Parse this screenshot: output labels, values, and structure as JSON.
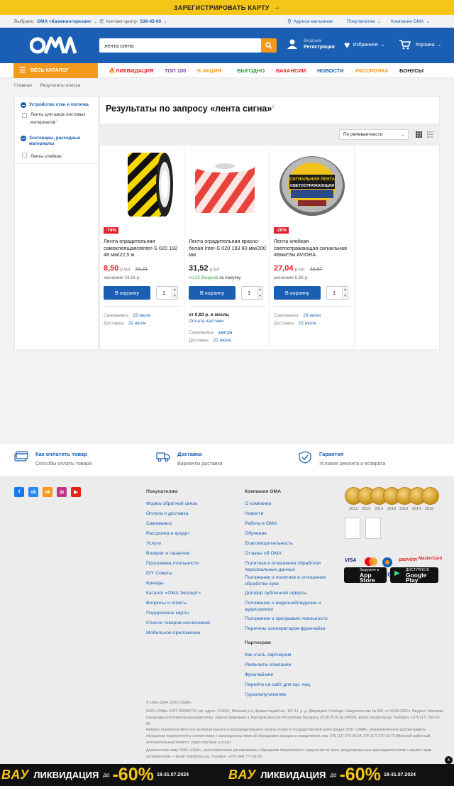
{
  "promo_top": {
    "label": "ЗАРЕГИСТРИРОВАТЬ КАРТУ"
  },
  "infobar": {
    "chosen_label": "Выбрано:",
    "chosen_store": "ОМА «Каменногорская»",
    "contact_label": "Контакт-центр:",
    "contact_phone": "536-45-00",
    "stores": "Адреса магазинов",
    "buyers": "Покупателям",
    "company": "Компания ОМА"
  },
  "header": {
    "logo": "ОМА",
    "search_value": "лента сигна",
    "login_small": "Вход или",
    "login_big": "Регистрация",
    "favorites": "Избранное",
    "cart": "Корзина"
  },
  "nav": {
    "catalog": "ВЕСЬ КАТАЛОГ",
    "items": [
      "ЛИКВИДАЦИЯ",
      "ТОП 100",
      "АКЦИЯ",
      "ВЫГОДНО",
      "ВАКАНСИИ",
      "НОВОСТИ",
      "РАССРОЧКА",
      "БОНУСЫ"
    ]
  },
  "breadcrumbs": [
    "Главная",
    "Результаты поиска"
  ],
  "sidebar": {
    "cat1": "Устройство стен и потолка",
    "cat1_item": "Ленты для швов листовых материалов",
    "cat1_count": "1",
    "cat2": "Хозтовары, расходные материалы",
    "cat2_item": "Ленты клейкие",
    "cat2_count": "1"
  },
  "results": {
    "title": "Результаты по запросу «лента сигна»",
    "count": "3",
    "sort": "По релевантности"
  },
  "products": [
    {
      "badge": "-74%",
      "name": "Лента оградительная самоклеящаясяInter-S 020 192 48 мм/22,5 м",
      "price": "8,50",
      "unit": "р./шт",
      "old_price": "33,31",
      "economy": "экономия 24,81 р.",
      "buy": "В корзину",
      "qty": "1",
      "pickup_label": "Самовывоз:",
      "pickup": "23 июля",
      "delivery_label": "Доставка:",
      "delivery": "22 июля"
    },
    {
      "name": "Лента оградительная красно-белая Inter-S 020 193 80 мм/200 мм",
      "price": "31,52",
      "unit": "р./шт",
      "bonus_value": "+0,32 бонусов",
      "bonus_suffix": "за покупку",
      "buy": "В корзину",
      "qty": "1",
      "credit": "от 0,83 р. в месяц",
      "credit_link": "Оплата частями",
      "pickup_label": "Самовывоз:",
      "pickup": "завтра",
      "delivery_label": "Доставка:",
      "delivery": "22 июля"
    },
    {
      "badge": "-20%",
      "name": "Лента клейкая светоотражающая сигнальная 48мм*5м AVIORA",
      "price": "27,04",
      "unit": "р./шт",
      "old_price": "33,87",
      "economy": "экономия 6,83 р.",
      "buy": "В корзину",
      "qty": "1",
      "pickup_label": "Самовывоз:",
      "pickup": "23 июля",
      "delivery_label": "Доставка:",
      "delivery": "22 июля"
    }
  ],
  "services": [
    {
      "title": "Как оплатить товар",
      "sub": "Способы оплаты товара"
    },
    {
      "title": "Доставка",
      "sub": "Варианты доставки"
    },
    {
      "title": "Гарантия",
      "sub": "Условия ремонта и возврата"
    }
  ],
  "footer": {
    "buyers_title": "Покупателям",
    "buyers": [
      "Форма обратной связи",
      "Оплата и доставка",
      "Самовывоз",
      "Рассрочка и кредит",
      "Услуги",
      "Возврат и гарантия",
      "Программа лояльности",
      "DIY Советы",
      "Бренды",
      "Каталог «ОМА Эксперт»",
      "Вопросы и ответы",
      "Подарочные карты",
      "Список товаров-исключений",
      "Мобильное приложение"
    ],
    "company_title": "Компания ОМА",
    "company": [
      "О компании",
      "Новости",
      "Работа в ОМА",
      "Обучение",
      "Благотворительность",
      "Отзывы об ОМА",
      "Политика в отношении обработки персональных данных",
      "Положение о политике в отношении обработки куки",
      "Договор публичной оферты",
      "Положение о видеонаблюдении и аудиозаписи",
      "Положение о программе лояльности",
      "Перечень сооператоров-франчайзи"
    ],
    "partners_title": "Партнерам",
    "partners": [
      "Как стать партнером",
      "Реквизиты компании",
      "Франчайзинг",
      "Перейти на сайт для юр. лиц",
      "Грузополучателям"
    ],
    "medal_years": [
      "2012",
      "2013",
      "2014",
      "2016",
      "2019",
      "2014",
      "2016"
    ],
    "app_store_small": "Загрузите в",
    "app_store": "App Store",
    "google_small": "ДОСТУПНО В",
    "google": "Google Play",
    "copyright": "© 1992–2024 ООО «ОМА»",
    "legal1": "ООО «ОМА» УНП 100005713, юр. адрес: 223021, Минский р-н, Щомыслицкий с/с, 107-11, р. д. Дворицкая Слобода. Свидетельство № 695, от 20.06.2000 г. Выдано: Минским городским исполнительным комитетом. Зарегистрировано в Торговом реестре Республики Беларусь 29.08.2016 № 349556. Email: oos@oma.by. Телефон: +375 (17) 330-10-00",
    "legal2": "Номера телефонов местного исполнительного и распорядительного органа по месту государственной регистрации ООО «ОМА», уполномоченного рассматривать обращения покупателей в соответствии с законодательством об обращениях граждан и юридических лиц: 375 (17) 270-29-14, 375 (17) 270-33-75 (Минский районный исполнительный комитет, отдел торговли и услуг)",
    "legal3": "Должностное лицо ООО «ОМА», уполномоченное рассматривать обращения покупателей о нарушении их прав, предусмотренных законодательством о защите прав потребителей — Email: bisk@oma.by, Телефон: +375 (44) 777-82-03"
  },
  "ad": {
    "vau": "ВАУ",
    "liq": "ЛИКВИДАЦИЯ",
    "do": "до",
    "pct": "-60%",
    "date": "18-31.07.2024",
    "close": "x"
  }
}
